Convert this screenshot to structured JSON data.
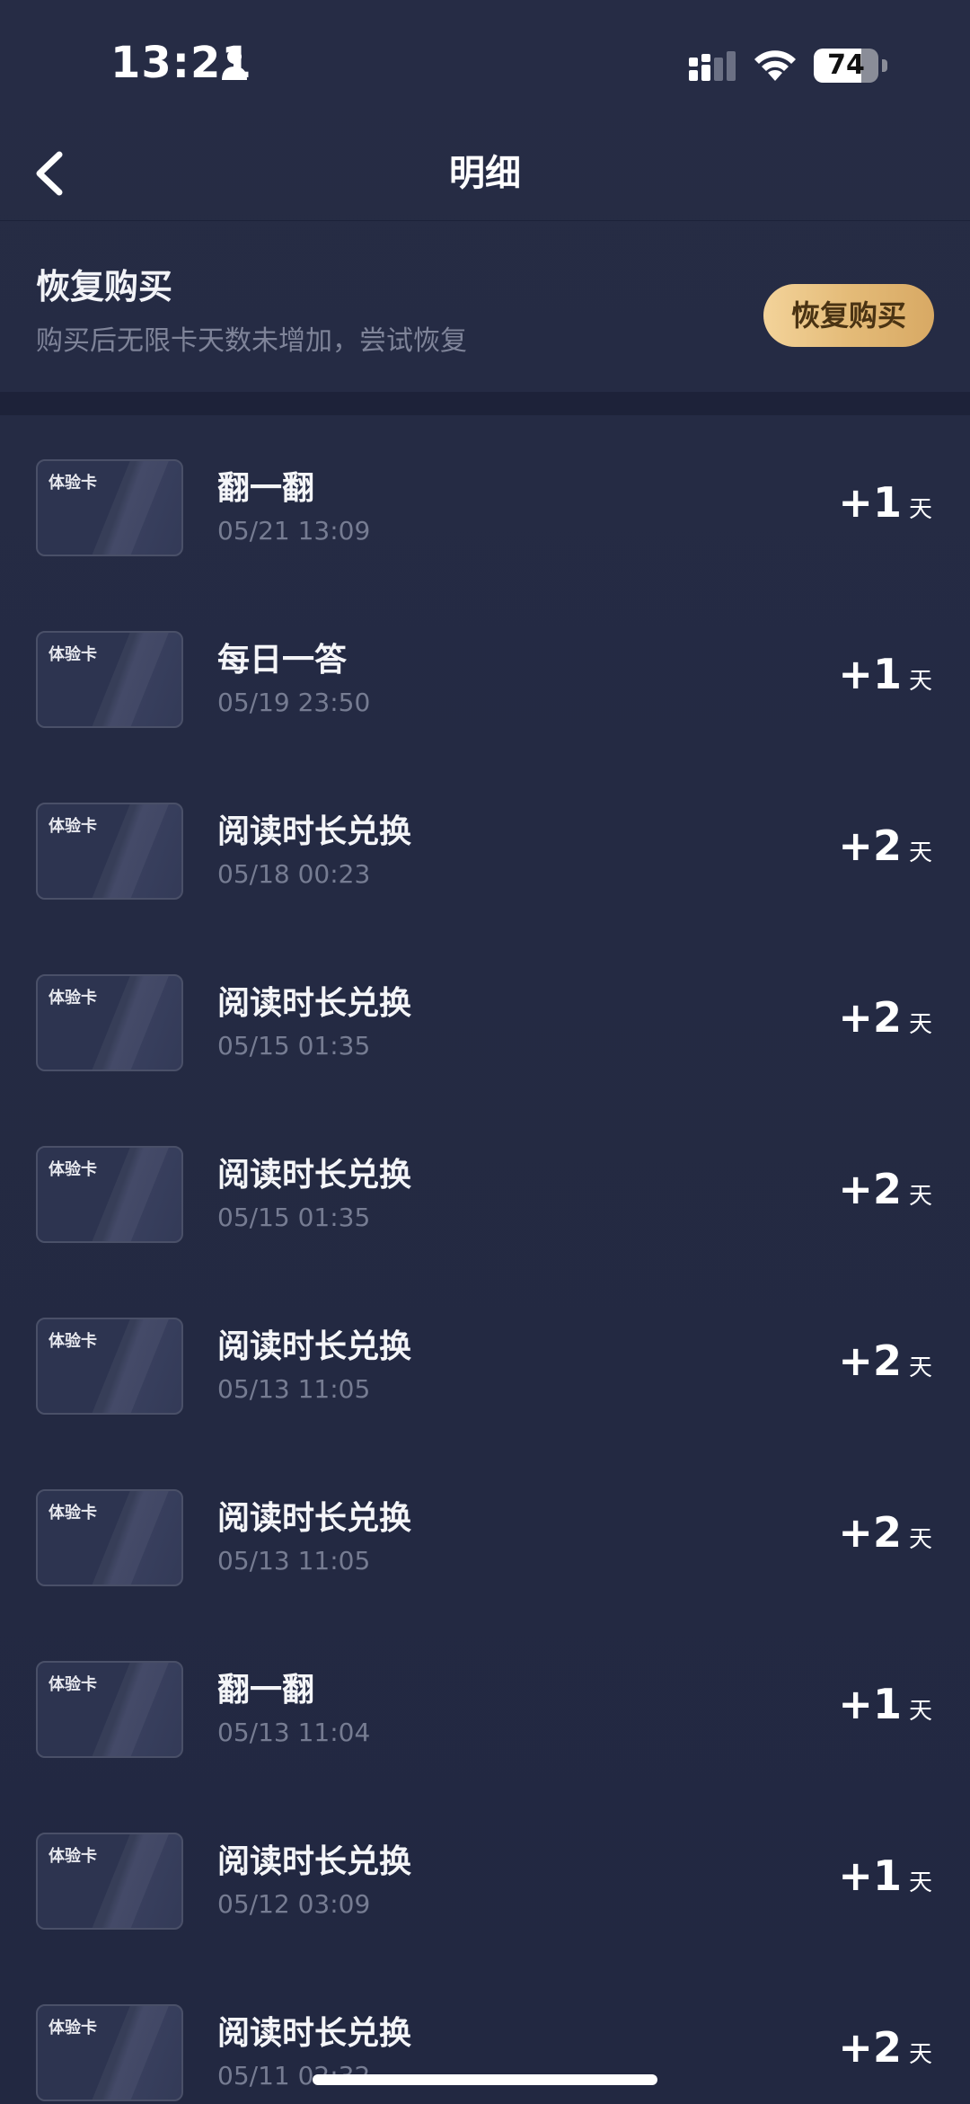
{
  "status_bar": {
    "time": "13:21",
    "battery_level": "74",
    "battery_fraction": 0.74
  },
  "nav": {
    "title": "明细"
  },
  "restore": {
    "title": "恢复购买",
    "description": "购买后无限卡天数未增加，尝试恢复",
    "button_label": "恢复购买",
    "button_colors": [
      "#f3d39a",
      "#d8a964"
    ]
  },
  "records": [
    {
      "card_label": "体验卡",
      "title": "翻一翻",
      "time": "05/21 13:09",
      "amount": "+1",
      "unit": "天"
    },
    {
      "card_label": "体验卡",
      "title": "每日一答",
      "time": "05/19 23:50",
      "amount": "+1",
      "unit": "天"
    },
    {
      "card_label": "体验卡",
      "title": "阅读时长兑换",
      "time": "05/18 00:23",
      "amount": "+2",
      "unit": "天"
    },
    {
      "card_label": "体验卡",
      "title": "阅读时长兑换",
      "time": "05/15 01:35",
      "amount": "+2",
      "unit": "天"
    },
    {
      "card_label": "体验卡",
      "title": "阅读时长兑换",
      "time": "05/15 01:35",
      "amount": "+2",
      "unit": "天"
    },
    {
      "card_label": "体验卡",
      "title": "阅读时长兑换",
      "time": "05/13 11:05",
      "amount": "+2",
      "unit": "天"
    },
    {
      "card_label": "体验卡",
      "title": "阅读时长兑换",
      "time": "05/13 11:05",
      "amount": "+2",
      "unit": "天"
    },
    {
      "card_label": "体验卡",
      "title": "翻一翻",
      "time": "05/13 11:04",
      "amount": "+1",
      "unit": "天"
    },
    {
      "card_label": "体验卡",
      "title": "阅读时长兑换",
      "time": "05/12 03:09",
      "amount": "+1",
      "unit": "天"
    },
    {
      "card_label": "体验卡",
      "title": "阅读时长兑换",
      "time": "05/11 02:32",
      "amount": "+2",
      "unit": "天"
    }
  ],
  "icons": {
    "back": "chevron-left-icon",
    "person": "person-icon",
    "signal": "cellular-signal-icon",
    "wifi": "wifi-icon",
    "battery": "battery-icon"
  },
  "colors": {
    "background": "#232a43",
    "divider": "#1d2239",
    "secondary_text": "#767c92"
  }
}
